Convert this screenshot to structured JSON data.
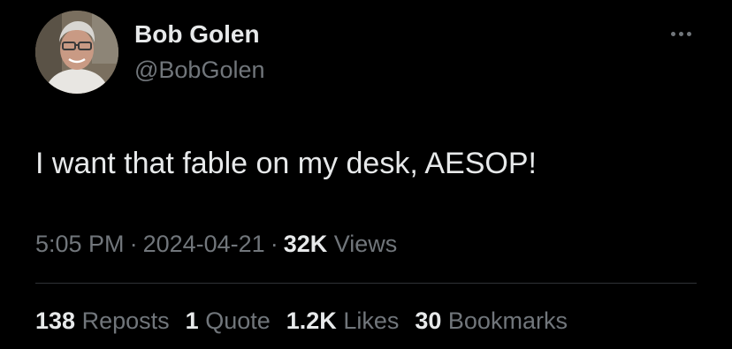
{
  "author": {
    "display_name": "Bob Golen",
    "handle": "@BobGolen"
  },
  "tweet": {
    "text": "I want that fable on my desk, AESOP!",
    "time": "5:05 PM",
    "date": "2024-04-21",
    "separator": "·",
    "views_count": "32K",
    "views_label": "Views"
  },
  "stats": [
    {
      "count": "138",
      "label": "Reposts"
    },
    {
      "count": "1",
      "label": "Quote"
    },
    {
      "count": "1.2K",
      "label": "Likes"
    },
    {
      "count": "30",
      "label": "Bookmarks"
    }
  ],
  "icons": {
    "more": "more-horizontal-icon"
  },
  "colors": {
    "background": "#000000",
    "primary_text": "#e7e9ea",
    "secondary_text": "#71767b",
    "divider": "#2f3336"
  }
}
